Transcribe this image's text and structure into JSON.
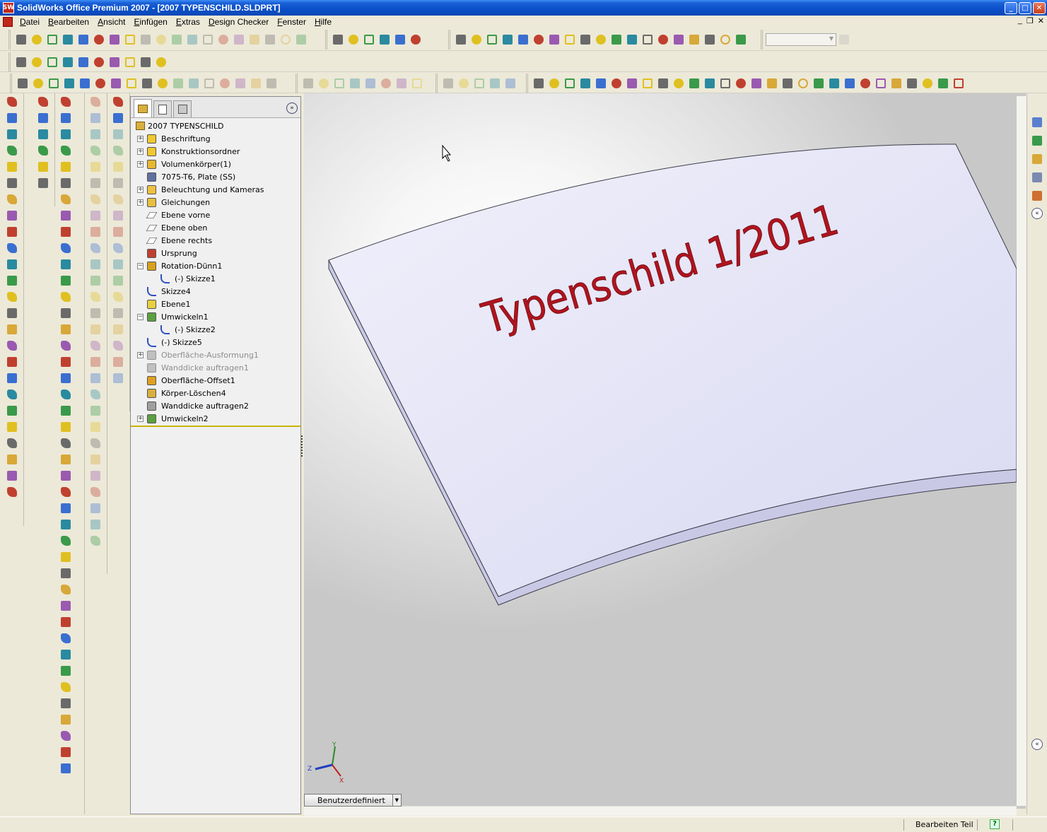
{
  "window": {
    "title": "SolidWorks Office Premium 2007 - [2007 TYPENSCHILD.SLDPRT]",
    "app_icon_text": "SW",
    "controls": [
      "_",
      "□",
      "✕"
    ]
  },
  "menu": {
    "items": [
      "Datei",
      "Bearbeiten",
      "Ansicht",
      "Einfügen",
      "Extras",
      "Design Checker",
      "Fenster",
      "Hilfe"
    ],
    "mdi_controls": [
      "_",
      "❐",
      "✕"
    ]
  },
  "feature_manager": {
    "expand_glyph": "»",
    "tabs": [
      "feature-manager-tab",
      "property-manager-tab",
      "configuration-manager-tab"
    ],
    "root": "2007 TYPENSCHILD",
    "nodes": [
      {
        "label": "Beschriftung",
        "icon": "annotation-icon",
        "expander": "+",
        "level": 0
      },
      {
        "label": "Konstruktionsordner",
        "icon": "design-binder-icon",
        "expander": "+",
        "level": 0
      },
      {
        "label": "Volumenkörper(1)",
        "icon": "solid-bodies-icon",
        "expander": "+",
        "level": 0
      },
      {
        "label": "7075-T6, Plate (SS)",
        "icon": "material-icon",
        "expander": "",
        "level": 0
      },
      {
        "label": "Beleuchtung und Kameras",
        "icon": "lights-cameras-icon",
        "expander": "+",
        "level": 0
      },
      {
        "label": "Gleichungen",
        "icon": "equations-icon",
        "expander": "+",
        "level": 0
      },
      {
        "label": "Ebene vorne",
        "icon": "plane-icon",
        "expander": "",
        "level": 0
      },
      {
        "label": "Ebene oben",
        "icon": "plane-icon",
        "expander": "",
        "level": 0
      },
      {
        "label": "Ebene rechts",
        "icon": "plane-icon",
        "expander": "",
        "level": 0
      },
      {
        "label": "Ursprung",
        "icon": "origin-icon",
        "expander": "",
        "level": 0
      },
      {
        "label": "Rotation-Dünn1",
        "icon": "revolve-icon",
        "expander": "−",
        "level": 0
      },
      {
        "label": "(-) Skizze1",
        "icon": "sketch-icon",
        "expander": "",
        "level": 1
      },
      {
        "label": "Skizze4",
        "icon": "sketch-icon",
        "expander": "",
        "level": 0
      },
      {
        "label": "Ebene1",
        "icon": "ref-plane-icon",
        "expander": "",
        "level": 0
      },
      {
        "label": "Umwickeln1",
        "icon": "wrap-icon",
        "expander": "−",
        "level": 0
      },
      {
        "label": "(-) Skizze2",
        "icon": "sketch-icon",
        "expander": "",
        "level": 1
      },
      {
        "label": "(-) Skizze5",
        "icon": "sketch-icon",
        "expander": "",
        "level": 0
      },
      {
        "label": "Oberfläche-Ausformung1",
        "icon": "surface-loft-icon",
        "expander": "+",
        "level": 0,
        "suppressed": true
      },
      {
        "label": "Wanddicke auftragen1",
        "icon": "thicken-icon",
        "expander": "",
        "level": 0,
        "suppressed": true
      },
      {
        "label": "Oberfläche-Offset1",
        "icon": "offset-surface-icon",
        "expander": "",
        "level": 0
      },
      {
        "label": "Körper-Löschen4",
        "icon": "delete-body-icon",
        "expander": "",
        "level": 0
      },
      {
        "label": "Wanddicke auftragen2",
        "icon": "thicken-icon",
        "expander": "",
        "level": 0
      },
      {
        "label": "Umwickeln2",
        "icon": "wrap-icon",
        "expander": "+",
        "level": 0
      }
    ]
  },
  "model": {
    "engraved_text": "Typenschild 1/2011",
    "text_color": "#b0141e",
    "plate_color": "#e4e4f6",
    "edge_color": "#c9c9e6"
  },
  "triad": {
    "x": "X",
    "y": "Y",
    "z": "Z"
  },
  "config_tab": {
    "label": "Benutzerdefiniert",
    "dropdown_glyph": "▼"
  },
  "right_panel": {
    "collapse_glyph": "«"
  },
  "status": {
    "mode": "Bearbeiten Teil",
    "help_glyph": "?"
  },
  "colors": {
    "title_bar": "#0a4fc8",
    "chrome": "#ece9d8",
    "tree_end_line": "#c8b400",
    "suppressed_text": "#8d8d8d"
  }
}
